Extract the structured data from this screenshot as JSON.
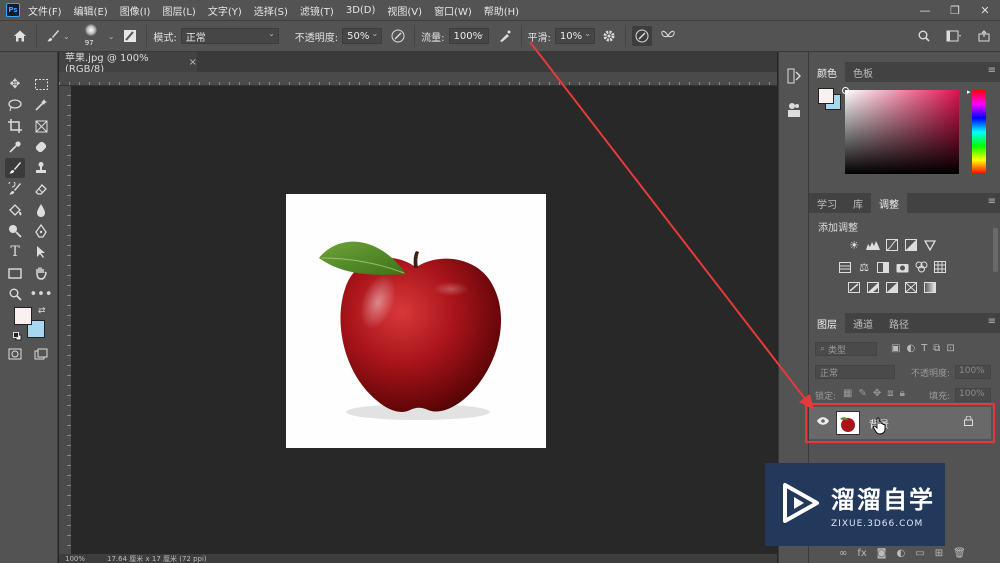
{
  "app": {
    "logo": "Ps",
    "menu": [
      "文件(F)",
      "编辑(E)",
      "图像(I)",
      "图层(L)",
      "文字(Y)",
      "选择(S)",
      "滤镜(T)",
      "3D(D)",
      "视图(V)",
      "窗口(W)",
      "帮助(H)"
    ],
    "window_controls": [
      "—",
      "❐",
      "✕"
    ]
  },
  "options": {
    "brush_size": "97",
    "mode_label": "模式:",
    "mode_value": "正常",
    "opacity_label": "不透明度:",
    "opacity_value": "50%",
    "flow_label": "流量:",
    "flow_value": "100%",
    "smoothing_label": "平滑:",
    "smoothing_value": "10%"
  },
  "document": {
    "tab_title": "苹果.jpg @ 100%(RGB/8)",
    "tab_close": "×",
    "status_zoom": "100%",
    "status_info": "17.64 厘米 x 17 厘米 (72 ppi)"
  },
  "panels": {
    "color_tabs": [
      "颜色",
      "色板"
    ],
    "adjust_tabs": [
      "学习",
      "库",
      "调整"
    ],
    "adjust_title": "添加调整",
    "layers_tabs": [
      "图层",
      "通道",
      "路径"
    ],
    "layers_filter_placeholder": "类型",
    "layers_mode": "正常",
    "layers_opacity_label": "不透明度:",
    "layers_opacity_value": "100%",
    "layers_lock_label": "锁定:",
    "layers_fill_label": "填充:",
    "layers_fill_value": "100%",
    "layer_name": "背景"
  },
  "colors": {
    "foreground": "#fbf0f0",
    "background": "#a8d8f0",
    "highlight": "#e53a3a",
    "arrow": "#e53a3a"
  },
  "watermark": {
    "title": "溜溜自学",
    "url": "ZIXUE.3D66.COM"
  }
}
